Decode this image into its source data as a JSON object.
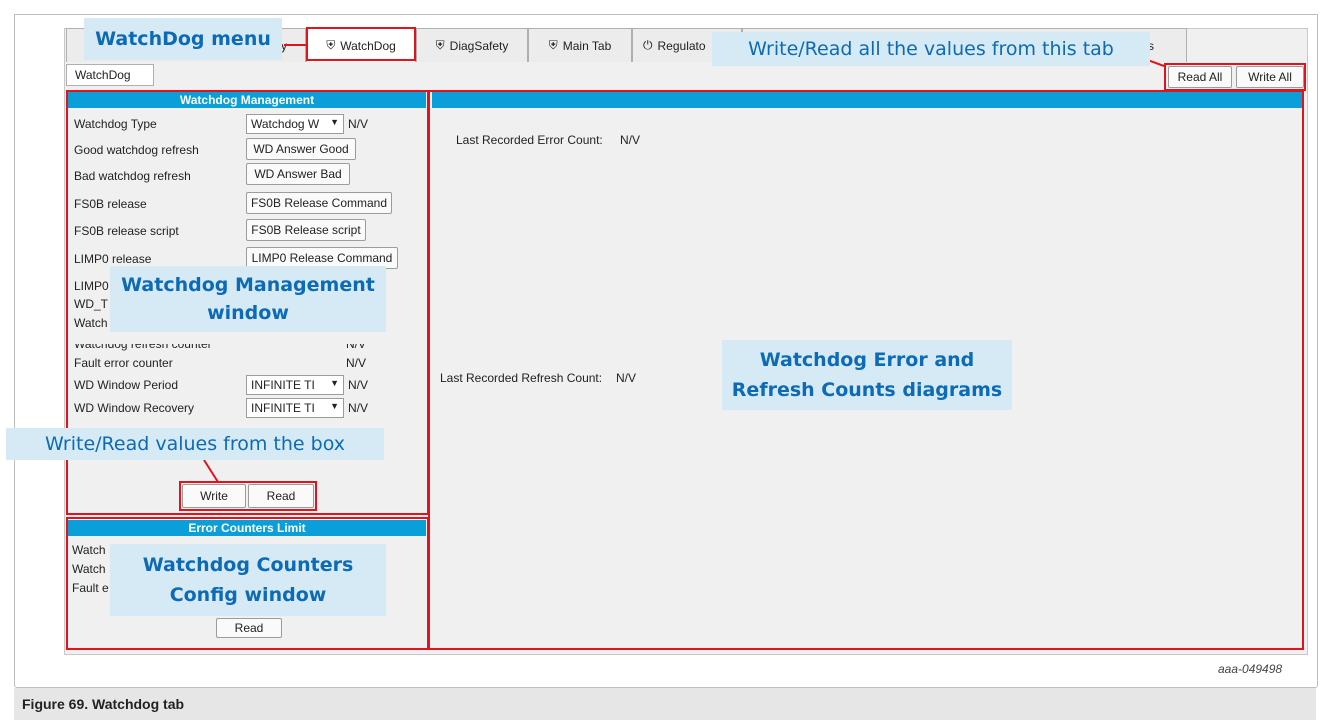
{
  "tabs": [
    {
      "label": "y",
      "icon": ""
    },
    {
      "label": "WatchDog",
      "icon": "shield-icon"
    },
    {
      "label": "DiagSafety",
      "icon": "shield-icon"
    },
    {
      "label": "Main Tab",
      "icon": "shield-icon"
    },
    {
      "label": "Regulato",
      "icon": "power-icon"
    },
    {
      "label": "yers",
      "icon": ""
    }
  ],
  "subtab": {
    "label": "WatchDog"
  },
  "toolbar": {
    "read_all": "Read All",
    "write_all": "Write All"
  },
  "wd_management": {
    "title": "Watchdog Management",
    "rows": [
      {
        "label": "Watchdog Type",
        "control": "select",
        "value": "Watchdog W",
        "status": "N/V"
      },
      {
        "label": "Good watchdog refresh",
        "control": "button",
        "value": "WD Answer Good"
      },
      {
        "label": "Bad watchdog refresh",
        "control": "button",
        "value": "WD Answer Bad"
      },
      {
        "label": "FS0B release",
        "control": "button",
        "value": "FS0B Release Command"
      },
      {
        "label": "FS0B release script",
        "control": "button",
        "value": "FS0B Release script"
      },
      {
        "label": "LIMP0 release",
        "control": "button",
        "value": "LIMP0 Release Command"
      }
    ],
    "partial_labels": [
      "LIMP0",
      "WD_T",
      "Watch",
      "Watchdog refresh counter"
    ],
    "lower_rows": [
      {
        "label": "Fault error counter",
        "status": "N/V"
      },
      {
        "label": "WD Window Period",
        "value": "INFINITE TI",
        "status": "N/V"
      },
      {
        "label": "WD Window Recovery",
        "value": "INFINITE TI",
        "status": "N/V"
      }
    ],
    "refresh_status": "N/V",
    "write": "Write",
    "read": "Read"
  },
  "error_counters": {
    "title": "Error Counters Limit",
    "partial_labels": [
      "Watch",
      "Watch",
      "Fault e"
    ],
    "read": "Read"
  },
  "diagram_panel": {
    "error_count_label": "Last Recorded Error Count:",
    "error_count_value": "N/V",
    "refresh_count_label": "Last Recorded Refresh Count:",
    "refresh_count_value": "N/V"
  },
  "callouts": {
    "watchdog_menu": "WatchDog menu",
    "write_read_all": "Write/Read all the values from this tab",
    "mgmt_window_line1": "Watchdog Management",
    "mgmt_window_line2": "window",
    "write_read_box": "Write/Read values from the box",
    "counters_line1": "Watchdog Counters",
    "counters_line2": "Config window",
    "diagrams_line1": "Watchdog Error and",
    "diagrams_line2": "Refresh Counts diagrams"
  },
  "figure_ref": "aaa-049498",
  "caption": "Figure 69.  Watchdog tab",
  "colors": {
    "accent": "#0a9fd8",
    "highlight_red": "#e0141c",
    "callout_bg": "#d5eaf5",
    "callout_text": "#0d6ab5"
  }
}
